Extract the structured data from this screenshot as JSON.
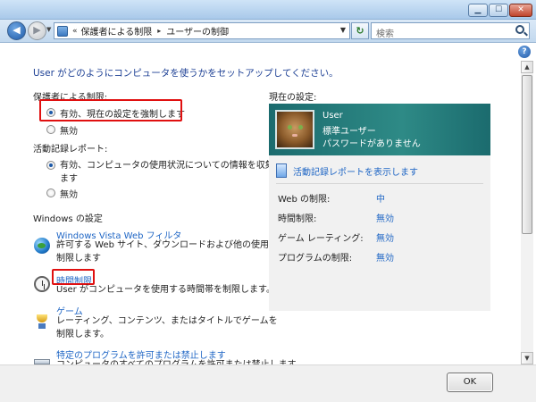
{
  "window": {
    "buttons": {
      "minimize": "▁",
      "maximize": "☐",
      "close": "✕"
    }
  },
  "nav": {
    "back_icon": "arrow-left-icon",
    "forward_icon": "arrow-right-icon",
    "chevron": "«",
    "breadcrumbs": [
      "保護者による制限",
      "ユーザーの制御"
    ],
    "search_placeholder": "検索"
  },
  "main": {
    "intro": "User がどのようにコンピュータを使うかをセットアップしてください。",
    "parental": {
      "heading": "保護者による制限:",
      "options": [
        {
          "label": "有効、現在の設定を強制します",
          "checked": true
        },
        {
          "label": "無効",
          "checked": false
        }
      ]
    },
    "activity": {
      "heading": "活動記録レポート:",
      "options": [
        {
          "label": "有効、コンピュータの使用状況についての情報を収集し",
          "label_line2": "ます",
          "checked": true
        },
        {
          "label": "無効",
          "checked": false
        }
      ]
    },
    "windows_settings": {
      "heading": "Windows の設定",
      "items": [
        {
          "title": "Windows Vista Web フィルタ",
          "desc_line1": "許可する Web サイト、ダウンロードおよび他の使用を",
          "desc_line2": "制限します",
          "icon": "globe-icon"
        },
        {
          "title": "時間制限",
          "desc_line1": "User がコンピュータを使用する時間帯を制限します。",
          "icon": "clock-icon"
        },
        {
          "title": "ゲーム",
          "desc_line1": "レーティング、コンテンツ、またはタイトルでゲームを",
          "desc_line2": "制限します。",
          "icon": "trophy-icon"
        },
        {
          "title": "特定のプログラムを許可または禁止します",
          "desc_line1": "コンピュータのすべてのプログラムを許可または禁止します",
          "icon": "program-icon"
        }
      ]
    }
  },
  "current": {
    "heading": "現在の設定:",
    "user_name": "User",
    "account_type": "標準ユーザー",
    "password_status": "パスワードがありません",
    "view_report": "活動記録レポートを表示します",
    "rows": [
      {
        "key": "Web の制限:",
        "value": "中"
      },
      {
        "key": "時間制限:",
        "value": "無効"
      },
      {
        "key": "ゲーム レーティング:",
        "value": "無効"
      },
      {
        "key": "プログラムの制限:",
        "value": "無効"
      }
    ]
  },
  "footer": {
    "ok_label": "OK"
  },
  "colors": {
    "link": "#1f66c5",
    "intro": "#1c3f94",
    "highlight": "#e01010",
    "user_panel": "#1b6b6e"
  }
}
